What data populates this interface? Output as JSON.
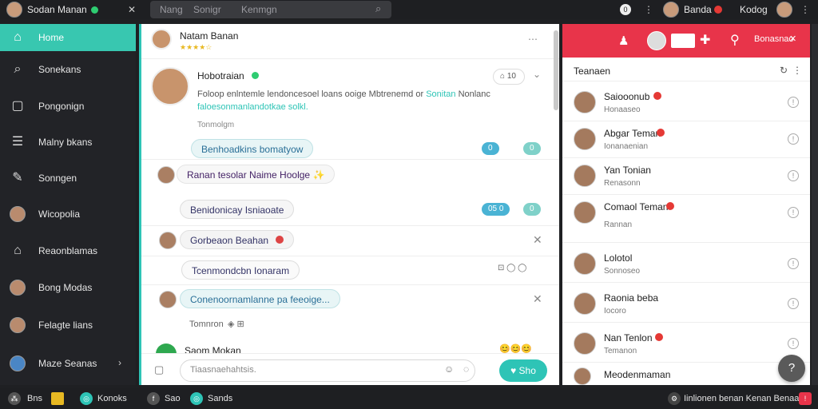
{
  "topbar": {
    "user_name": "Sodan Manan",
    "search_label": "Nang",
    "search_tab1": "Sonigr",
    "search_tab2": "Kenmgn",
    "right_name": "Banda",
    "right_label": "Kodog"
  },
  "sidebar": {
    "items": [
      {
        "label": "Home",
        "icon": "home-icon"
      },
      {
        "label": "Sonekans",
        "icon": "search-icon"
      },
      {
        "label": "Pongonign",
        "icon": "square-icon"
      },
      {
        "label": "Malny bkans",
        "icon": "ladder-icon"
      },
      {
        "label": "Sonngen",
        "icon": "edit-icon"
      },
      {
        "label": "Wicopolia",
        "icon": "avatar"
      },
      {
        "label": "Reaonblamas",
        "icon": "store-icon"
      },
      {
        "label": "Bong Modas",
        "icon": "avatar"
      },
      {
        "label": "Felagte lians",
        "icon": "avatar"
      },
      {
        "label": "Maze Seanas",
        "icon": "avatar"
      }
    ]
  },
  "chat": {
    "header_name": "Natam Banan",
    "post": {
      "author": "Hobotraian",
      "meta": "Tonmolgm",
      "body_start": "Foloop enlntemle lendoncesoel loans ooige Mbtrenemd or",
      "body_link1": "Sonitan",
      "body_end": "Nonlanc",
      "body_line2": "faloesonmanlandotkae solkl.",
      "badge": "10"
    },
    "messages": [
      {
        "text": "Benhoadkins bomatyow",
        "tags": [
          "0",
          "0"
        ]
      },
      {
        "text": "Ranan tesolar Naime Hoolge",
        "emoji": "✨"
      },
      {
        "text": "Benidonicay Isniaoate",
        "tags": [
          "05 0",
          "0"
        ]
      },
      {
        "text": "Gorbeaon Beahan"
      },
      {
        "text": "Tcenmondcbn Ionaram"
      },
      {
        "text": "Conenoornamlanne pa feeoige..."
      },
      {
        "text": "Tomnron"
      },
      {
        "text": "Saom Mokan"
      }
    ],
    "composer_placeholder": "Tiaasnaehahtsis.",
    "send_label": "Sho"
  },
  "contacts_panel": {
    "title": "Teanaen",
    "header_action": "Bonasnao",
    "contacts": [
      {
        "name": "Saiooonub",
        "sub": "Honaaseo"
      },
      {
        "name": "Abgar Teman",
        "sub": "Ionanaenian"
      },
      {
        "name": "Yan Tonian",
        "sub": "Renasonn"
      },
      {
        "name": "Comaol Teman",
        "sub": "Rannan"
      },
      {
        "name": "Lolotol",
        "sub": "Sonnoseo"
      },
      {
        "name": "Raonia beba",
        "sub": "Iocoro"
      },
      {
        "name": "Nan Tenlon",
        "sub": "Temanon"
      },
      {
        "name": "Meodenmaman",
        "sub": ""
      }
    ]
  },
  "bottombar": {
    "items": [
      "Bns",
      "Konoks",
      "Sao",
      "Sands"
    ],
    "right_text": "Iinlionen benan  Kenan  Benaan"
  },
  "colors": {
    "accent": "#2ec4b6",
    "red": "#e8344a",
    "dark": "#1e1f22"
  }
}
